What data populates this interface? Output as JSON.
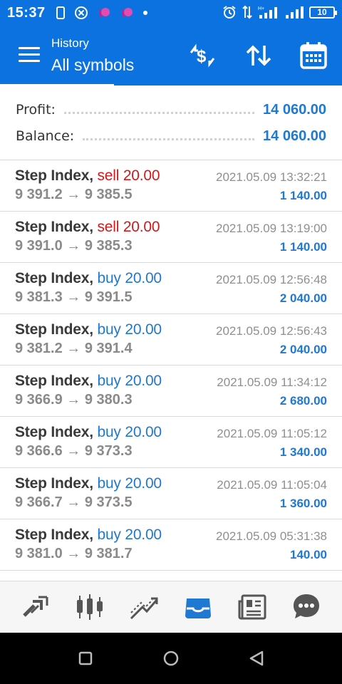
{
  "status_bar": {
    "time": "15:37",
    "battery": "10"
  },
  "header": {
    "subtitle": "History",
    "title": "All symbols"
  },
  "summary": {
    "profit_label": "Profit:",
    "profit_value": "14 060.00",
    "balance_label": "Balance:",
    "balance_value": "14 060.00"
  },
  "trades": [
    {
      "symbol": "Step Index,",
      "action": "sell 20.00",
      "side": "sell",
      "prices": "9 391.2 → 9 385.5",
      "time": "2021.05.09 13:32:21",
      "profit": "1 140.00"
    },
    {
      "symbol": "Step Index,",
      "action": "sell 20.00",
      "side": "sell",
      "prices": "9 391.0 → 9 385.3",
      "time": "2021.05.09 13:19:00",
      "profit": "1 140.00"
    },
    {
      "symbol": "Step Index,",
      "action": "buy 20.00",
      "side": "buy",
      "prices": "9 381.3 → 9 391.5",
      "time": "2021.05.09 12:56:48",
      "profit": "2 040.00"
    },
    {
      "symbol": "Step Index,",
      "action": "buy 20.00",
      "side": "buy",
      "prices": "9 381.2 → 9 391.4",
      "time": "2021.05.09 12:56:43",
      "profit": "2 040.00"
    },
    {
      "symbol": "Step Index,",
      "action": "buy 20.00",
      "side": "buy",
      "prices": "9 366.9 → 9 380.3",
      "time": "2021.05.09 11:34:12",
      "profit": "2 680.00"
    },
    {
      "symbol": "Step Index,",
      "action": "buy 20.00",
      "side": "buy",
      "prices": "9 366.6 → 9 373.3",
      "time": "2021.05.09 11:05:12",
      "profit": "1 340.00"
    },
    {
      "symbol": "Step Index,",
      "action": "buy 20.00",
      "side": "buy",
      "prices": "9 366.7 → 9 373.5",
      "time": "2021.05.09 11:05:04",
      "profit": "1 360.00"
    },
    {
      "symbol": "Step Index,",
      "action": "buy 20.00",
      "side": "buy",
      "prices": "9 381.0 → 9 381.7",
      "time": "2021.05.09 05:31:38",
      "profit": "140.00"
    }
  ],
  "colors": {
    "accent": "#0b72e0",
    "sell": "#d11a1a",
    "buy": "#1f78d1",
    "profit": "#1f78d1",
    "nav_icon": "#555555",
    "nav_active": "#1f78d1"
  },
  "icons": {
    "header": [
      "menu-icon",
      "currency-exchange-icon",
      "sort-icon",
      "calendar-icon"
    ],
    "bottom_nav": [
      "quotes-icon",
      "chart-icon",
      "trade-icon",
      "history-icon",
      "news-icon",
      "messages-icon"
    ],
    "active_tab": "history-icon"
  }
}
